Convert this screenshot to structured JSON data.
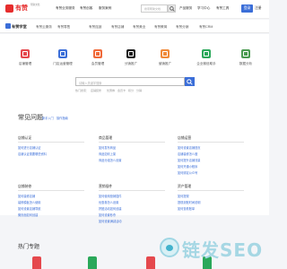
{
  "topbar": {
    "logo_text": "有赞",
    "logo_sub": "帮助文档",
    "links": [
      "有赞业务服务",
      "有赞创客",
      "服务案例"
    ],
    "search_placeholder": "搜索帮助文档",
    "right_links": [
      "产品服务",
      "学习中心",
      "有赞工具"
    ],
    "login": "登录",
    "register": "注册"
  },
  "nav": {
    "logo_text": "有赞学堂",
    "items": [
      "有赞云服务",
      "有赞零售",
      "有赞连锁",
      "有赞店铺",
      "有赞美业",
      "有赞教育",
      "有赞分销",
      "有赞CRM"
    ]
  },
  "features": [
    {
      "label": "店铺管理",
      "color": "#e5484d"
    },
    {
      "label": "门店运营管理",
      "color": "#3b6ed8"
    },
    {
      "label": "会员管理",
      "color": "#f06a3a"
    },
    {
      "label": "分销推广",
      "color": "#1a1a1a"
    },
    {
      "label": "营销推广",
      "color": "#f08a3a"
    },
    {
      "label": "企业微信助手",
      "color": "#2aa85a"
    },
    {
      "label": "数据分析",
      "color": "#4a9a50"
    }
  ],
  "search": {
    "placeholder": "请输入关键字搜索",
    "hot_label": "热门搜索：",
    "hot_keywords": [
      "店铺装修",
      "优惠券",
      "会员卡",
      "积分",
      "分销"
    ]
  },
  "faq": {
    "title": "常见问题",
    "tags": [
      "新手入门",
      "操作指南"
    ],
    "categories": [
      {
        "title": "店铺认证",
        "items": [
          "如何进行店铺认证",
          "店铺认证需要哪些资料"
        ]
      },
      {
        "title": "商品管理",
        "items": [
          "如何发布商品",
          "商品如何上架",
          "商品分组怎么设置"
        ]
      },
      {
        "title": "店铺运营",
        "items": [
          "如何设置店铺首页",
          "店铺装修怎么做",
          "如何提升店铺流量",
          "如何开通小程序",
          "如何绑定公众号"
        ]
      },
      {
        "title": "店铺装修",
        "items": [
          "如何装修店铺",
          "装修模板怎么使用",
          "如何设置店铺导航",
          "微页面如何创建"
        ]
      },
      {
        "title": "营销插件",
        "items": [
          "如何使用营销插件",
          "优惠券怎么设置",
          "拼团活动如何创建",
          "如何设置秒杀",
          "如何设置满减活动"
        ]
      },
      {
        "title": "资产管理",
        "items": [
          "如何提现",
          "提现到账时间说明",
          "如何查看账单"
        ]
      }
    ]
  },
  "hot_topics": {
    "title": "热门专题",
    "colors": [
      "#e5484d",
      "#2aa85a",
      "#e5484d",
      "#2aa85a"
    ]
  },
  "watermark": {
    "text": "链发SEO"
  }
}
